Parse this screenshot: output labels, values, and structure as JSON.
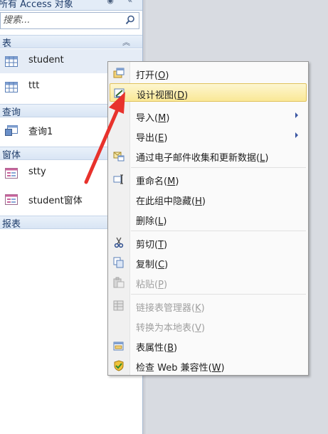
{
  "nav": {
    "title": "所有 Access 对象",
    "search_placeholder": "搜索...",
    "groups": [
      {
        "label": "表",
        "items": [
          {
            "label": "student"
          },
          {
            "label": "ttt"
          }
        ]
      },
      {
        "label": "查询",
        "items": [
          {
            "label": "查询1"
          }
        ]
      },
      {
        "label": "窗体",
        "items": [
          {
            "label": "stty"
          },
          {
            "label": "student窗体"
          }
        ]
      },
      {
        "label": "报表",
        "items": []
      }
    ]
  },
  "menu": {
    "items": [
      {
        "label": "打开",
        "key": "O",
        "icon": "open-icon",
        "enabled": true
      },
      {
        "label": "设计视图",
        "key": "D",
        "icon": "design-view-icon",
        "enabled": true,
        "highlighted": true
      },
      {
        "label": "导入",
        "key": "M",
        "icon": "",
        "enabled": true,
        "submenu": true
      },
      {
        "label": "导出",
        "key": "E",
        "icon": "",
        "enabled": true,
        "submenu": true
      },
      {
        "label": "通过电子邮件收集和更新数据",
        "key": "L",
        "icon": "email-collect-icon",
        "enabled": true
      },
      {
        "label": "重命名",
        "key": "M",
        "icon": "rename-icon",
        "enabled": true
      },
      {
        "label": "在此组中隐藏",
        "key": "H",
        "icon": "",
        "enabled": true
      },
      {
        "label": "删除",
        "key": "L",
        "icon": "",
        "enabled": true
      },
      {
        "label": "剪切",
        "key": "T",
        "icon": "scissors-icon",
        "enabled": true
      },
      {
        "label": "复制",
        "key": "C",
        "icon": "copy-icon",
        "enabled": true
      },
      {
        "label": "粘贴",
        "key": "P",
        "icon": "paste-icon",
        "enabled": false
      },
      {
        "label": "链接表管理器",
        "key": "K",
        "icon": "linked-table-manager-icon",
        "enabled": false
      },
      {
        "label": "转换为本地表",
        "key": "V",
        "icon": "",
        "enabled": false
      },
      {
        "label": "表属性",
        "key": "B",
        "icon": "table-properties-icon",
        "enabled": true
      },
      {
        "label": "检查 Web 兼容性",
        "key": "W",
        "icon": "web-compat-check-icon",
        "enabled": true
      }
    ]
  },
  "colors": {
    "accent_arrow": "#e8322c",
    "highlight": "#fae896",
    "nav_group_bg": "#dfe8f5"
  }
}
